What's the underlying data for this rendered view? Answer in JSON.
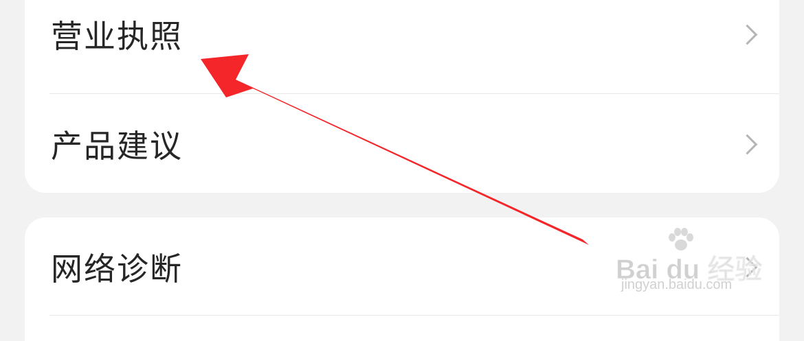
{
  "settings": {
    "group1": [
      {
        "label": "营业执照",
        "icon": "chevron-right-icon"
      },
      {
        "label": "产品建议",
        "icon": "chevron-right-icon"
      }
    ],
    "group2": [
      {
        "label": "网络诊断",
        "icon": "chevron-right-icon"
      }
    ]
  },
  "annotation": {
    "arrow_color": "#f5262a"
  },
  "watermark": {
    "brand": "Bai du 经验",
    "url": "jingyan.baidu.com"
  }
}
